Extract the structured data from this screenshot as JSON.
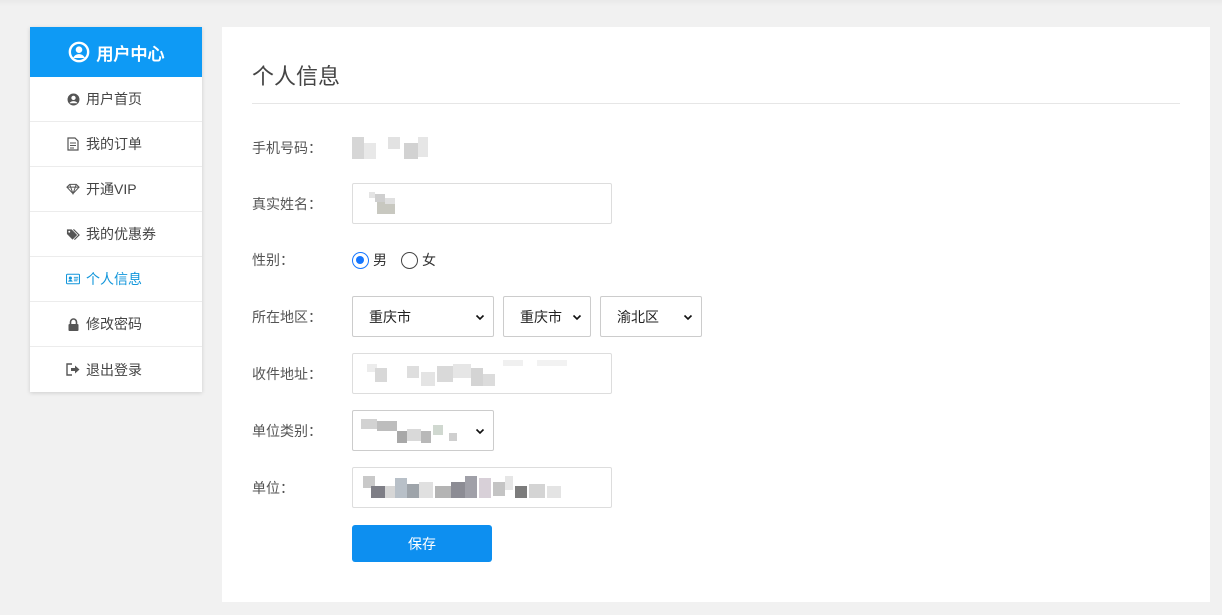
{
  "sidebar": {
    "title": "用户中心",
    "items": [
      {
        "label": "用户首页",
        "icon": "user-circle-icon"
      },
      {
        "label": "我的订单",
        "icon": "document-icon"
      },
      {
        "label": "开通VIP",
        "icon": "diamond-icon"
      },
      {
        "label": "我的优惠券",
        "icon": "tags-icon"
      },
      {
        "label": "个人信息",
        "icon": "id-card-icon",
        "active": true
      },
      {
        "label": "修改密码",
        "icon": "lock-icon"
      },
      {
        "label": "退出登录",
        "icon": "sign-out-icon"
      }
    ]
  },
  "main": {
    "title": "个人信息",
    "form": {
      "phone_label": "手机号码：",
      "name_label": "真实姓名：",
      "gender_label": "性别：",
      "gender_options": [
        "男",
        "女"
      ],
      "gender_selected": "男",
      "region_label": "所在地区：",
      "province": "重庆市",
      "city": "重庆市",
      "district": "渝北区",
      "address_label": "收件地址：",
      "unit_type_label": "单位类别：",
      "unit_label": "单位：",
      "save_label": "保存"
    }
  },
  "colors": {
    "accent": "#0e9af5",
    "active_link": "#1296db",
    "radio_checked": "#1677ff"
  }
}
